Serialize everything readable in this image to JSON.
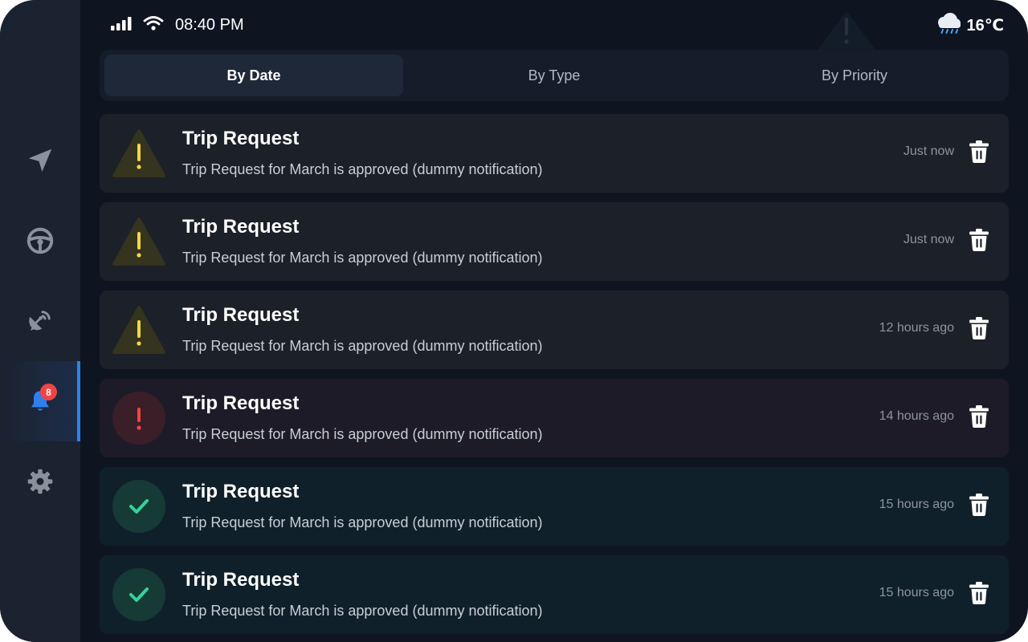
{
  "status": {
    "time": "08:40 PM",
    "temperature": "16℃",
    "weather_icon": "rain-cloud-icon"
  },
  "sidebar": {
    "items": [
      {
        "icon": "navigation-icon",
        "active": false
      },
      {
        "icon": "steering-wheel-icon",
        "active": false
      },
      {
        "icon": "satellite-dish-icon",
        "active": false
      },
      {
        "icon": "bell-icon",
        "active": true,
        "badge": "8"
      },
      {
        "icon": "gear-icon",
        "active": false
      }
    ]
  },
  "tabs": [
    {
      "label": "By Date",
      "active": true
    },
    {
      "label": "By Type",
      "active": false
    },
    {
      "label": "By Priority",
      "active": false
    }
  ],
  "notifications": [
    {
      "type": "warning",
      "title": "Trip Request",
      "message": "Trip Request for March is approved (dummy notification)",
      "time": "Just now"
    },
    {
      "type": "warning",
      "title": "Trip Request",
      "message": "Trip Request for March is approved (dummy notification)",
      "time": "Just now"
    },
    {
      "type": "warning",
      "title": "Trip Request",
      "message": "Trip Request for March is approved (dummy notification)",
      "time": "12 hours ago"
    },
    {
      "type": "error",
      "title": "Trip Request",
      "message": "Trip Request for March is approved (dummy notification)",
      "time": "14 hours ago"
    },
    {
      "type": "success",
      "title": "Trip Request",
      "message": "Trip Request for March is approved (dummy notification)",
      "time": "15 hours ago"
    },
    {
      "type": "success",
      "title": "Trip Request",
      "message": "Trip Request for March is approved (dummy notification)",
      "time": "15 hours ago"
    }
  ],
  "colors": {
    "accent": "#2f80ed",
    "warning": "#f5d547",
    "error": "#ef4444",
    "success": "#34d399",
    "badge": "#ef4444"
  }
}
